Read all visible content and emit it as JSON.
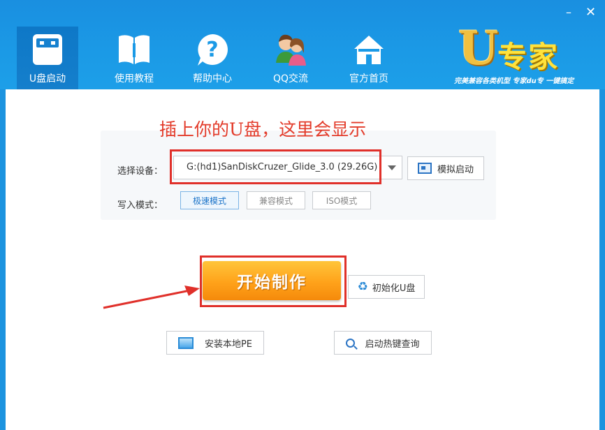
{
  "window": {
    "controls": {
      "minimize": "–",
      "close": "✕"
    }
  },
  "nav": {
    "items": [
      {
        "label": "U盘启动",
        "icon": "usb-drive-icon",
        "active": true
      },
      {
        "label": "使用教程",
        "icon": "book-icon",
        "active": false
      },
      {
        "label": "帮助中心",
        "icon": "help-icon",
        "active": false
      },
      {
        "label": "QQ交流",
        "icon": "users-icon",
        "active": false
      },
      {
        "label": "官方首页",
        "icon": "home-icon",
        "active": false
      }
    ]
  },
  "logo": {
    "letter": "U",
    "text": "专家",
    "slogan": "完美兼容各类机型  专家du专  一键搞定"
  },
  "annotation": "插上你的U盘，这里会显示",
  "device": {
    "label": "选择设备：",
    "selected": "G:(hd1)SanDiskCruzer_Glide_3.0 (29.26G)"
  },
  "simulate_button": "模拟启动",
  "mode": {
    "label": "写入模式：",
    "options": [
      "极速模式",
      "兼容模式",
      "ISO模式"
    ],
    "selected": "极速模式"
  },
  "start_button": "开始制作",
  "init_button": "初始化U盘",
  "install_pe_button": "安装本地PE",
  "hotkey_button": "启动热键查询",
  "colors": {
    "accent": "#1b9ae6",
    "start_orange": "#ffa21a",
    "annotation_red": "#e33b2a"
  }
}
